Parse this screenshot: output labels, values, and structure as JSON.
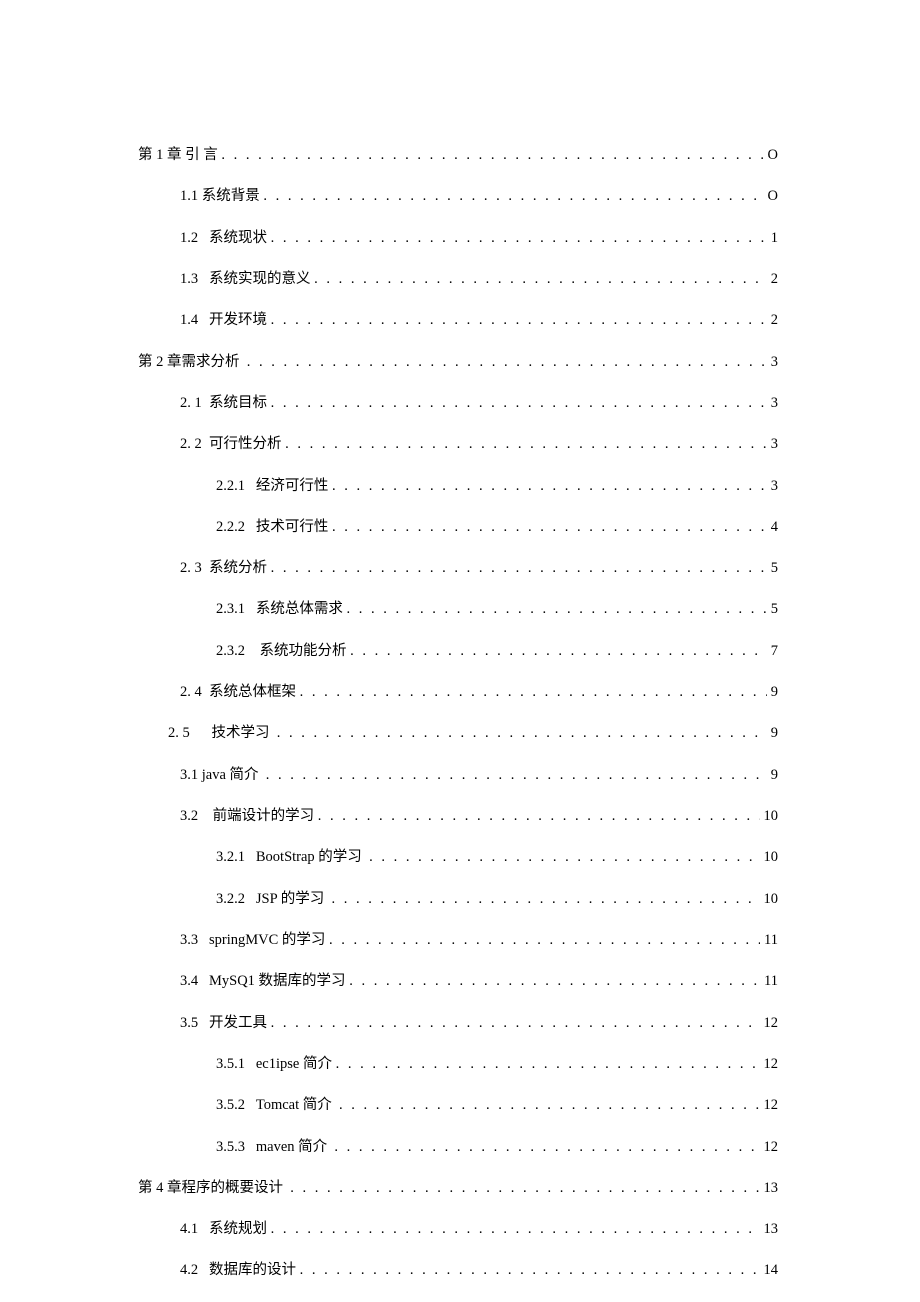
{
  "toc": [
    {
      "level": 0,
      "num": "",
      "title": "第 1 章 引 言 ",
      "page": "O"
    },
    {
      "level": 1,
      "num": "1.1 ",
      "title": "系统背景 ",
      "page": "O"
    },
    {
      "level": 1,
      "num": "1.2   ",
      "title": "系统现状 ",
      "page": "1"
    },
    {
      "level": 1,
      "num": "1.3   ",
      "title": "系统实现的意义 ",
      "page": "2"
    },
    {
      "level": 1,
      "num": "1.4   ",
      "title": "开发环境 ",
      "page": "2"
    },
    {
      "level": 0,
      "num": "",
      "title": "第 2 章需求分析  ",
      "page": "3"
    },
    {
      "level": 1,
      "num": "2. 1  ",
      "title": "系统目标 ",
      "page": "3"
    },
    {
      "level": 1,
      "num": "2. 2  ",
      "title": "可行性分析 ",
      "page": "3"
    },
    {
      "level": 2,
      "num": "2.2.1   ",
      "title": "经济可行性 ",
      "page": "3"
    },
    {
      "level": 2,
      "num": "2.2.2   ",
      "title": "技术可行性 ",
      "page": "4"
    },
    {
      "level": 1,
      "num": "2. 3  ",
      "title": "系统分析 ",
      "page": "5"
    },
    {
      "level": 2,
      "num": "2.3.1   ",
      "title": "系统总体需求 ",
      "page": "5"
    },
    {
      "level": 2,
      "num": "2.3.2    ",
      "title": "系统功能分析 ",
      "page": "7"
    },
    {
      "level": 1,
      "num": "2. 4  ",
      "title": "系统总体框架 ",
      "page": "9"
    },
    {
      "level": -1,
      "num": "2. 5      ",
      "title": "技术学习  ",
      "page": "9"
    },
    {
      "level": 1,
      "num": "",
      "title": "3.1 java 简介  ",
      "page": "9"
    },
    {
      "level": 1,
      "num": "3.2    ",
      "title": "前端设计的学习 ",
      "page": "10"
    },
    {
      "level": 2,
      "num": "3.2.1   ",
      "title": "BootStrap 的学习  ",
      "page": "10"
    },
    {
      "level": 2,
      "num": "3.2.2   ",
      "title": "JSP 的学习  ",
      "page": "10"
    },
    {
      "level": 1,
      "num": "3.3   ",
      "title": "springMVC 的学习 ",
      "page": "11"
    },
    {
      "level": 1,
      "num": "3.4   ",
      "title": "MySQ1 数据库的学习 ",
      "page": "11"
    },
    {
      "level": 1,
      "num": "3.5   ",
      "title": "开发工具 ",
      "page": "12"
    },
    {
      "level": 2,
      "num": "3.5.1   ",
      "title": "ec1ipse 简介 ",
      "page": "12"
    },
    {
      "level": 2,
      "num": "3.5.2   ",
      "title": "Tomcat 简介  ",
      "page": "12"
    },
    {
      "level": 2,
      "num": "3.5.3   ",
      "title": "maven 简介  ",
      "page": "12"
    },
    {
      "level": 0,
      "num": "",
      "title": "第 4 章程序的概要设计  ",
      "page": "13"
    },
    {
      "level": 1,
      "num": "4.1   ",
      "title": "系统规划 ",
      "page": "13"
    },
    {
      "level": 1,
      "num": "4.2   ",
      "title": "数据库的设计 ",
      "page": "14"
    }
  ]
}
